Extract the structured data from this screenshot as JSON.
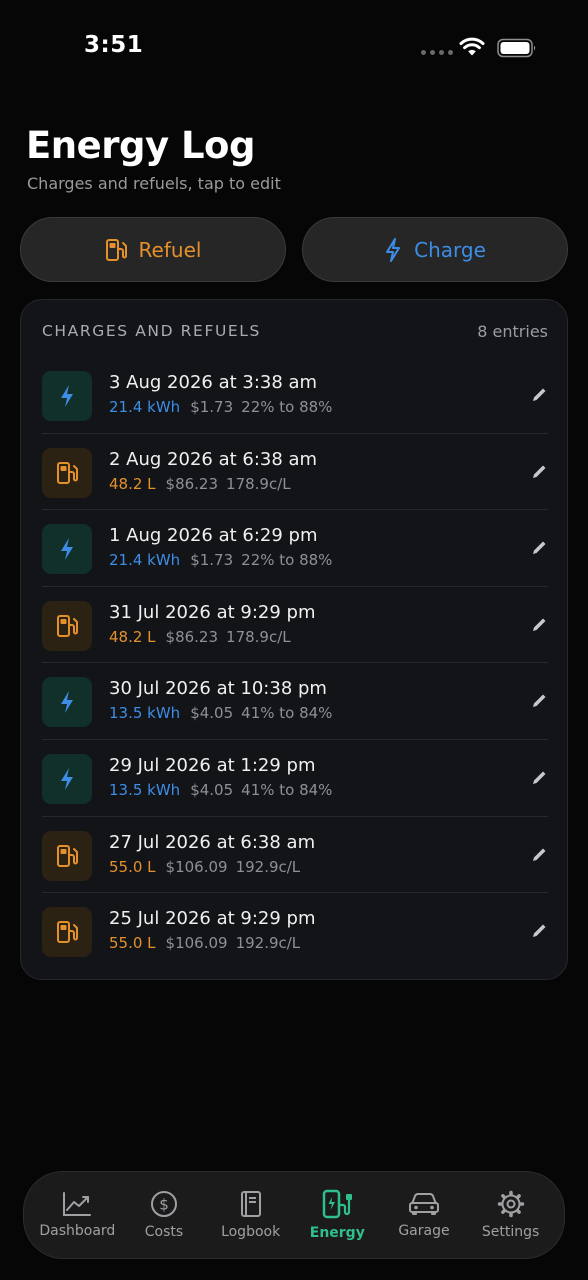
{
  "status": {
    "time": "3:51"
  },
  "header": {
    "title": "Energy Log",
    "subtitle": "Charges and refuels, tap to edit"
  },
  "actions": {
    "refuel_label": "Refuel",
    "charge_label": "Charge"
  },
  "log": {
    "heading": "CHARGES AND REFUELS",
    "count": "8 entries",
    "entries": [
      {
        "type": "charge",
        "title": "3 Aug 2026 at 3:38 am",
        "amount": "21.4 kWh",
        "cost": "$1.73",
        "extra": "22% to 88%"
      },
      {
        "type": "refuel",
        "title": "2 Aug 2026 at 6:38 am",
        "amount": "48.2 L",
        "cost": "$86.23",
        "extra": "178.9c/L"
      },
      {
        "type": "charge",
        "title": "1 Aug 2026 at 6:29 pm",
        "amount": "21.4 kWh",
        "cost": "$1.73",
        "extra": "22% to 88%"
      },
      {
        "type": "refuel",
        "title": "31 Jul 2026 at 9:29 pm",
        "amount": "48.2 L",
        "cost": "$86.23",
        "extra": "178.9c/L"
      },
      {
        "type": "charge",
        "title": "30 Jul 2026 at 10:38 pm",
        "amount": "13.5 kWh",
        "cost": "$4.05",
        "extra": "41% to 84%"
      },
      {
        "type": "charge",
        "title": "29 Jul 2026 at 1:29 pm",
        "amount": "13.5 kWh",
        "cost": "$4.05",
        "extra": "41% to 84%"
      },
      {
        "type": "refuel",
        "title": "27 Jul 2026 at 6:38 am",
        "amount": "55.0 L",
        "cost": "$106.09",
        "extra": "192.9c/L"
      },
      {
        "type": "refuel",
        "title": "25 Jul 2026 at 9:29 pm",
        "amount": "55.0 L",
        "cost": "$106.09",
        "extra": "192.9c/L"
      }
    ]
  },
  "tabs": [
    {
      "label": "Dashboard",
      "icon": "chart-icon"
    },
    {
      "label": "Costs",
      "icon": "dollar-icon"
    },
    {
      "label": "Logbook",
      "icon": "book-icon"
    },
    {
      "label": "Energy",
      "icon": "ev-charger-icon",
      "active": true
    },
    {
      "label": "Garage",
      "icon": "car-icon"
    },
    {
      "label": "Settings",
      "icon": "gear-icon"
    }
  ],
  "colors": {
    "background": "#060606",
    "charge_accent": "#3d8de6",
    "refuel_accent": "#e4912c",
    "active_tab": "#2fbf8a"
  }
}
